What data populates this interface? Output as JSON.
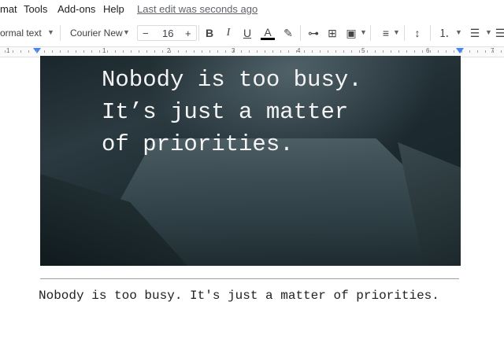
{
  "menu": {
    "items": [
      "mat",
      "Tools",
      "Add-ons",
      "Help"
    ],
    "last_edit": "Last edit was seconds ago"
  },
  "toolbar": {
    "style": "ormal text",
    "font": "Courier New",
    "font_size": "16",
    "minus": "−",
    "plus": "+"
  },
  "ruler": {
    "numbers": [
      "1",
      "1",
      "2",
      "3",
      "4",
      "5",
      "6",
      "7"
    ]
  },
  "image": {
    "quote": "Nobody is too busy.\nIt’s just a matter\nof priorities."
  },
  "document": {
    "text": "Nobody is too busy. It's just a matter of priorities."
  },
  "colors": {
    "accent": "#4285f4",
    "text": "#202124"
  }
}
